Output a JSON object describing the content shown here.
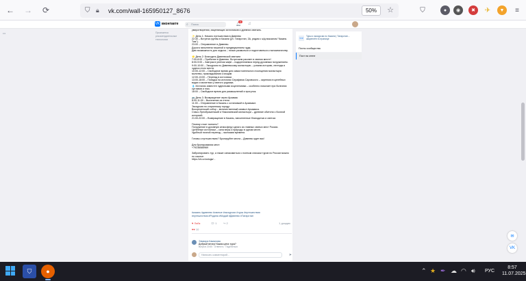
{
  "browser": {
    "url": "vk.com/wall-165950127_8676",
    "zoom": "50%"
  },
  "vk": {
    "logo_text": "вконтакте",
    "search_placeholder": "Поиск",
    "notif_count": "9"
  },
  "left": {
    "text": "Признается\nрекомендательные\nтехнологии"
  },
  "post": {
    "body": "умиротворения, исцеляющих источников и древних святынь.\n\n✨ День 1: Начало путешествия в Дивеево\n22:30 – Встреча группы в Казани (ул. Татарстан, 3А, рядом с ж/д вокзалом \"Казань Том\").\n23:00 – Отправление в Дивеево.\nДорога наполнена тишиной и предвкушением чуда.\nДаю возможность для отдыха – ночью размыться и подготовиться к паломничеству.\n\n🌟 День 2: Благодать Дивеевской святыни\n7:00-8:00 – Прибытие в Дивеево. Встречаем рассвет в святом месте!\n8:00-9:00 – Завтрак в уютном кафе – подкрепляемся перед духовным погружением.\n9:00-10:00 – Экскурсия по Дивеевскому монастырю – узнаем историю, легенды и чудеса этого места.\n10:00-12:00 – Свободное время для самостоятельного посещения монастыря: молитвы, прикладывания к мощам\n12:00-13:00 – Переезд в источники.\n13:00-18:00 – Поездка на источник Серафима Саровского – окунемся в целебных водах и молитвах у святого родника.\n💧 Источник известен чудесными исцелениями – особенно помогает при болезнях суставов и глаз.\n18:00 – Свободное время для размышлений и прогулок.\n\n🚌 День 3: Возвращение через Арзамас\n8:00-11:00 – Выселение из отеля.\n11:00 – Отправление в Казань с остановкой в Арзамасе.\nЭкскурсия по старинному городу:\nВоскресенский собор – величественный символ Арзамаса.\nСпасо-Преображенский и Николаевский монастыри – древние обители с богатой историей.\n21:00-22:00 – Возвращение в Казань, наполненные благодатью и светом.\n\nПочему стоит поехать?\nПогружение в духовную атмосферу одного из главных святых мест России.\nЦелебные источники – сила веры и природы в одном месте.\nУдобный ночной переезд – экономия времени.\n\nГотовы к путешествию? Бронируйте места – Дивеево ждет вас!\n\nДля бронирования мест:\n+79236585969\n\nЗабронировать тур, а также ознакомиться с полным списком туров по России можно по ссылке:\nhttps://vk.cc/usluga/...",
    "hashtags": "#казань #дивеево #святые #экскурсии #туры #путешествия\n#путешествия #Родина #Модай #Дивеево #Татарстан",
    "like_label": "Лайк",
    "like_count": "2",
    "comment_count": "1",
    "share_count": "2",
    "views": "1 дождик",
    "reacts_count": "10"
  },
  "comment": {
    "author": "Эльвира Камалова",
    "text": "Добрый вечер! Какая цена тура?",
    "meta": "вчера в 20:55 · Ответить · Поделиться"
  },
  "comment_input": {
    "placeholder": "Написать комментарий..."
  },
  "sidebar": {
    "card_text": "Туры и экскурсии по Казани | Татарстан... закреплён в странице",
    "card_img_label": "ТУР",
    "link1": "Посты сообщества",
    "link2": "Пост на стене"
  },
  "taskbar": {
    "lang": "РУС",
    "time": "8:57",
    "date": "11.07.2025"
  }
}
